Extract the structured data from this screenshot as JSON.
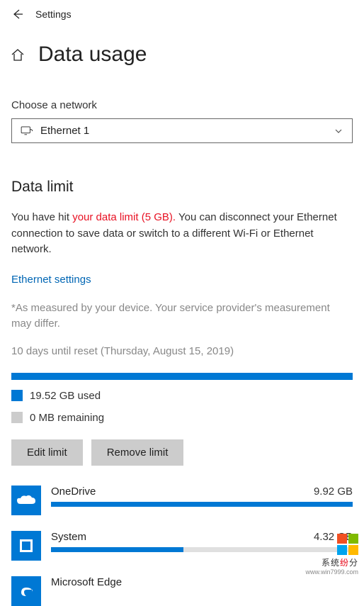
{
  "header": {
    "title": "Settings"
  },
  "page": {
    "title": "Data usage"
  },
  "network": {
    "label": "Choose a network",
    "selected": "Ethernet 1"
  },
  "dataLimit": {
    "title": "Data limit",
    "warningPrefix": "You have hit ",
    "warningRed": "your data limit (5 GB).",
    "warningSuffix": "  You can disconnect your Ethernet connection to save data or switch to a different Wi-Fi or Ethernet network.",
    "settingsLink": "Ethernet settings",
    "disclaimer": "*As measured by your device. Your service provider's measurement may differ.",
    "resetInfo": "10 days until reset (Thursday, August 15, 2019)",
    "used": "19.52 GB used",
    "remaining": "0 MB remaining",
    "editBtn": "Edit limit",
    "removeBtn": "Remove limit"
  },
  "apps": [
    {
      "name": "OneDrive",
      "size": "9.92 GB",
      "pct": 100
    },
    {
      "name": "System",
      "size": "4.32 GB",
      "pct": 44
    },
    {
      "name": "Microsoft Edge",
      "size": "",
      "pct": 0
    }
  ],
  "watermark": {
    "brand1": "系统",
    "brand2": "纷",
    "brand3": "分",
    "url": "www.win7999.com"
  }
}
